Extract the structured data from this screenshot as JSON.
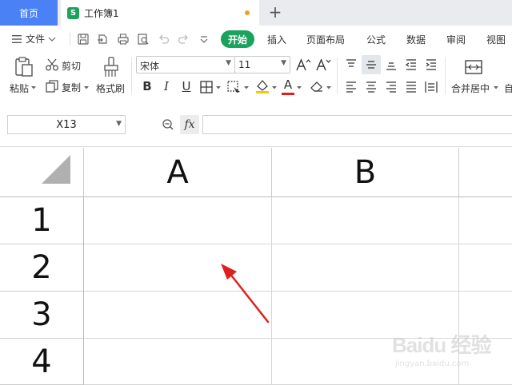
{
  "tabs": {
    "home_label": "首页",
    "doc_logo": "S",
    "doc_title": "工作簿1",
    "add_label": "+"
  },
  "menu": {
    "file_label": "文件",
    "start_label": "开始",
    "items": [
      "插入",
      "页面布局",
      "公式",
      "数据",
      "审阅",
      "视图"
    ]
  },
  "ribbon": {
    "paste_label": "粘贴",
    "cut_label": "剪切",
    "copy_label": "复制",
    "format_painter_label": "格式刷",
    "font_name": "宋体",
    "font_size": "11",
    "bold_label": "B",
    "italic_label": "I",
    "underline_label": "U",
    "font_color_label": "A",
    "merge_center_label": "合并居中",
    "next_label": "自"
  },
  "formula_bar": {
    "name_box": "X13",
    "fx_label": "fx",
    "formula_value": ""
  },
  "sheet": {
    "columns": [
      "A",
      "B"
    ],
    "rows": [
      "1",
      "2",
      "3",
      "4"
    ]
  },
  "watermark": {
    "text": "Baidu 经验",
    "sub": "jingyan.baidu.com"
  },
  "colors": {
    "home_tab": "#4a82f6",
    "start_pill": "#1ba25c",
    "annotation_arrow": "#e02020"
  }
}
